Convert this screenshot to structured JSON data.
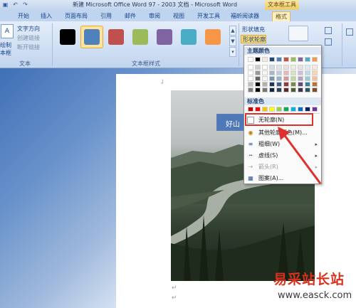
{
  "titlebar": {
    "title": "新建 Microsoft Office Word 97 - 2003 文档 - Microsoft Word",
    "contextual_tab": "文本框工具",
    "qat_icons": [
      "save-icon",
      "undo-icon",
      "redo-icon"
    ]
  },
  "tabs": [
    {
      "label": "开始"
    },
    {
      "label": "插入"
    },
    {
      "label": "页面布局"
    },
    {
      "label": "引用"
    },
    {
      "label": "邮件"
    },
    {
      "label": "审阅"
    },
    {
      "label": "视图"
    },
    {
      "label": "开发工具"
    },
    {
      "label": "福昕阅读器"
    },
    {
      "label": "格式"
    }
  ],
  "ribbon": {
    "text_group": {
      "draw_label": "绘制",
      "textbox_label": "本框",
      "items": [
        "文字方向",
        "创建链接",
        "断开链接"
      ],
      "group_label": "文本"
    },
    "styles_group": {
      "group_label": "文本框样式",
      "swatches": [
        "#000000",
        "#4f81bd",
        "#c0504d",
        "#9bbb59",
        "#8064a2",
        "#4bacc6",
        "#f79646"
      ]
    },
    "shape_fill": "形状填充",
    "shape_outline": "形状轮廓"
  },
  "textbox": {
    "text": "好山"
  },
  "dropdown": {
    "theme_colors_label": "主题颜色",
    "standard_colors_label": "标准色",
    "theme_colors": [
      "#ffffff",
      "#000000",
      "#eeece1",
      "#1f497d",
      "#4f81bd",
      "#c0504d",
      "#9bbb59",
      "#8064a2",
      "#4bacc6",
      "#f79646"
    ],
    "standard_colors": [
      "#c00000",
      "#ff0000",
      "#ffc000",
      "#ffff00",
      "#92d050",
      "#00b050",
      "#00b0f0",
      "#0070c0",
      "#002060",
      "#7030a0"
    ],
    "items": [
      {
        "label": "无轮廓(N)"
      },
      {
        "label": "其他轮廓颜色(M)..."
      },
      {
        "label": "粗细(W)"
      },
      {
        "label": "虚线(S)"
      },
      {
        "label": "箭头(R)"
      },
      {
        "label": "图案(A)..."
      }
    ]
  },
  "watermark": {
    "name": "易采站长站",
    "url": "www.easck.com"
  }
}
